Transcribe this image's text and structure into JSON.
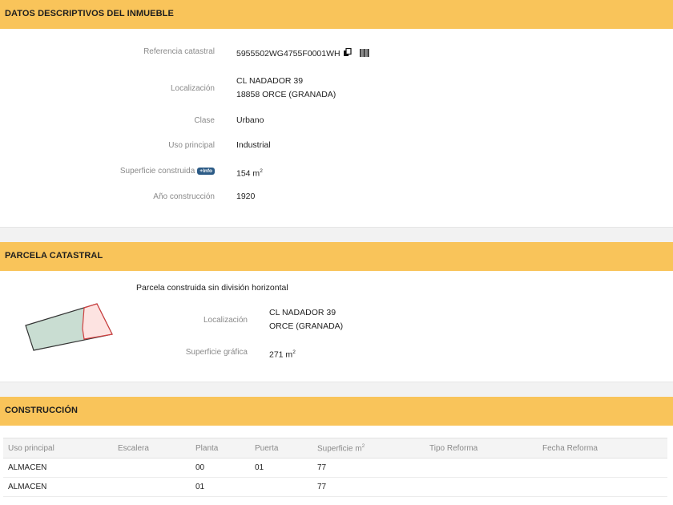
{
  "inmueble": {
    "title": "DATOS DESCRIPTIVOS DEL INMUEBLE",
    "ref_label": "Referencia catastral",
    "ref_value": "5955502WG4755F0001WH",
    "loc_label": "Localización",
    "loc_line1": "CL NADADOR 39",
    "loc_line2": "18858 ORCE (GRANADA)",
    "clase_label": "Clase",
    "clase_value": "Urbano",
    "uso_label": "Uso principal",
    "uso_value": "Industrial",
    "sup_label": "Superficie construida",
    "info_label": "+Info",
    "sup_value": "154 m",
    "sup_unit_exp": "2",
    "anio_label": "Año construcción",
    "anio_value": "1920"
  },
  "parcela": {
    "title": "PARCELA CATASTRAL",
    "subtitle": "Parcela construida sin división horizontal",
    "loc_label": "Localización",
    "loc_line1": "CL NADADOR 39",
    "loc_line2": "ORCE (GRANADA)",
    "sup_label": "Superficie gráfica",
    "sup_value": "271 m",
    "sup_unit_exp": "2"
  },
  "construccion": {
    "title": "CONSTRUCCIÓN",
    "headers": [
      "Uso principal",
      "Escalera",
      "Planta",
      "Puerta",
      "Superficie m",
      "Tipo Reforma",
      "Fecha Reforma"
    ],
    "sup_header_exp": "2",
    "rows": [
      [
        "ALMACEN",
        "",
        "00",
        "01",
        "77",
        "",
        ""
      ],
      [
        "ALMACEN",
        "",
        "01",
        "",
        "77",
        "",
        ""
      ]
    ]
  },
  "icons": {
    "copy": "copy-icon",
    "barcode": "barcode-icon",
    "parcel_map": "parcel-map-icon"
  },
  "colors": {
    "header_bg": "#f9c45a",
    "badge_bg": "#2c5b86",
    "parcel_fill": "#c9ddd2",
    "building_fill": "#fde3e1",
    "building_stroke": "#d04040"
  }
}
